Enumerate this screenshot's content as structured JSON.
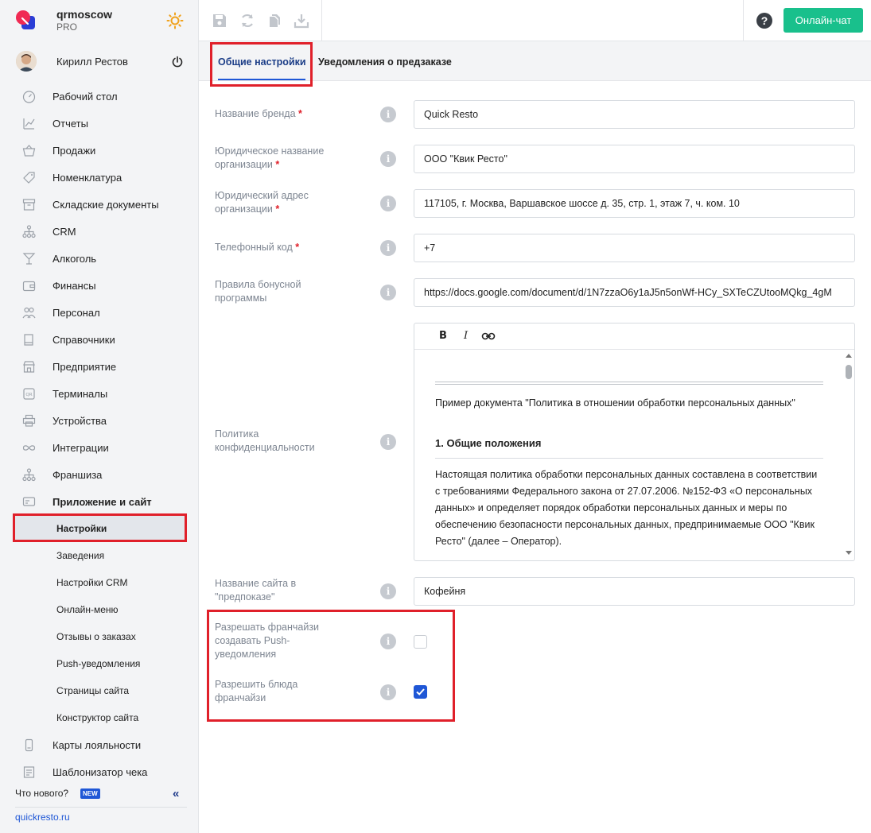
{
  "brand": {
    "name": "qrmoscow",
    "plan": "PRO"
  },
  "user": {
    "name": "Кирилл Рестов"
  },
  "nav": {
    "items": [
      {
        "label": "Рабочий стол",
        "icon": "speedometer-icon"
      },
      {
        "label": "Отчеты",
        "icon": "chart-line-icon"
      },
      {
        "label": "Продажи",
        "icon": "basket-icon"
      },
      {
        "label": "Номенклатура",
        "icon": "tag-icon"
      },
      {
        "label": "Складские документы",
        "icon": "archive-icon"
      },
      {
        "label": "CRM",
        "icon": "hierarchy-icon"
      },
      {
        "label": "Алкоголь",
        "icon": "cocktail-icon"
      },
      {
        "label": "Финансы",
        "icon": "wallet-icon"
      },
      {
        "label": "Персонал",
        "icon": "people-icon"
      },
      {
        "label": "Справочники",
        "icon": "book-icon"
      },
      {
        "label": "Предприятие",
        "icon": "store-icon"
      },
      {
        "label": "Терминалы",
        "icon": "qr-icon"
      },
      {
        "label": "Устройства",
        "icon": "printer-icon"
      },
      {
        "label": "Интеграции",
        "icon": "infinity-icon"
      },
      {
        "label": "Франшиза",
        "icon": "hierarchy-icon"
      },
      {
        "label": "Приложение и сайт",
        "icon": "app-icon"
      }
    ],
    "subitems": [
      {
        "label": "Настройки"
      },
      {
        "label": "Заведения"
      },
      {
        "label": "Настройки CRM"
      },
      {
        "label": "Онлайн-меню"
      },
      {
        "label": "Отзывы о заказах"
      },
      {
        "label": "Push-уведомления"
      },
      {
        "label": "Страницы сайта"
      },
      {
        "label": "Конструктор сайта"
      }
    ],
    "after": [
      {
        "label": "Карты лояльности",
        "icon": "card-icon"
      },
      {
        "label": "Шаблонизатор чека",
        "icon": "receipt-icon"
      }
    ]
  },
  "footer": {
    "whats_new": "Что нового?",
    "new_badge": "NEW",
    "site": "quickresto.ru"
  },
  "topbar": {
    "chat_label": "Онлайн-чат",
    "help": "?"
  },
  "tabs": [
    {
      "label": "Общие настройки",
      "active": true
    },
    {
      "label": "Уведомления о предзаказе",
      "active": false
    }
  ],
  "form": {
    "brand_name": {
      "label": "Название бренда",
      "value": "Quick Resto"
    },
    "legal_name": {
      "label1": "Юридическое название",
      "label2": "организации",
      "value": "ООО \"Квик Ресто\""
    },
    "legal_address": {
      "label1": "Юридический адрес",
      "label2": "организации",
      "value": "117105, г. Москва, Варшавское шоссе д. 35, стр. 1, этаж 7, ч. ком. 10"
    },
    "phone_code": {
      "label": "Телефонный код",
      "value": "+7"
    },
    "bonus_rules": {
      "label1": "Правила бонусной",
      "label2": "программы",
      "value": "https://docs.google.com/document/d/1N7zzaO6y1aJ5n5onWf-HCy_SXTeCZUtooMQkg_4gM"
    },
    "privacy": {
      "label1": "Политика",
      "label2": "конфиденциальности",
      "toolbar": {
        "bold": "B",
        "italic": "I"
      },
      "intro": "Пример документа \"Политика в отношении обработки персональных данных\"",
      "heading": "1. Общие положения",
      "text": "Настоящая политика обработки персональных данных составлена в соответствии с требованиями Федерального закона от 27.07.2006. №152-ФЗ «О персональных данных» и определяет порядок обработки персональных данных и меры по обеспечению безопасности персональных данных, предпринимаемые ООО \"Квик Ресто\" (далее – Оператор)."
    },
    "site_name": {
      "label1": "Название сайта в",
      "label2": "\"предпоказе\"",
      "value": "Кофейня"
    },
    "franchise_push": {
      "label1": "Разрешать франчайзи",
      "label2": "создавать Push-",
      "label3": "уведомления",
      "checked": false
    },
    "franchise_dishes": {
      "label1": "Разрешить блюда",
      "label2": "франчайзи",
      "checked": true
    },
    "required_mark": "*",
    "info_glyph": "i"
  },
  "colors": {
    "accent": "#1f57d6",
    "chat": "#19c08c",
    "highlight": "#e0202a",
    "sidebar_bg": "#f3f4f6"
  }
}
